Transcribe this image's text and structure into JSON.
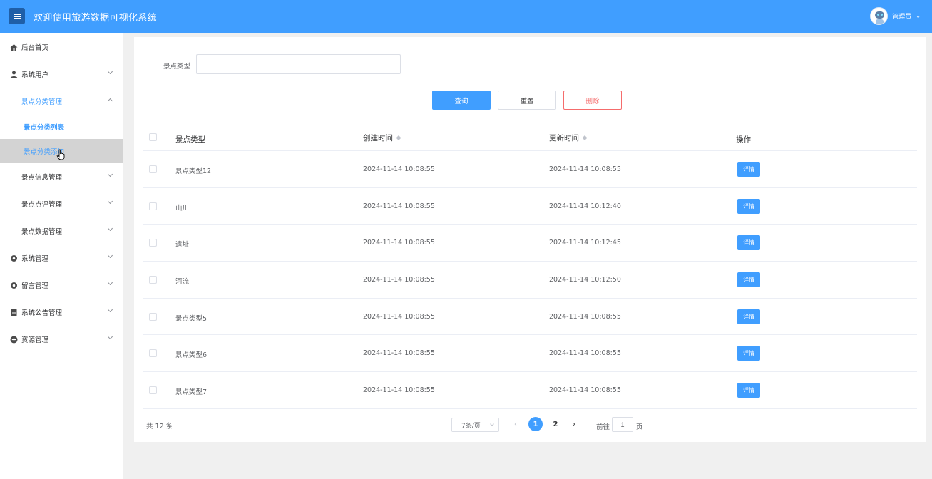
{
  "app": {
    "title": "欢迎使用旅游数据可视化系统"
  },
  "user": {
    "name": "管理员",
    "caret": "⌄"
  },
  "sidebar": {
    "items": [
      {
        "label": "后台首页"
      },
      {
        "label": "系统用户"
      },
      {
        "label": "景点分类管理"
      },
      {
        "label": "景点信息管理"
      },
      {
        "label": "景点点评管理"
      },
      {
        "label": "景点数据管理"
      },
      {
        "label": "系统管理"
      },
      {
        "label": "留言管理"
      },
      {
        "label": "系统公告管理"
      },
      {
        "label": "资源管理"
      }
    ],
    "sub_items": [
      {
        "label": "景点分类列表"
      },
      {
        "label": "景点分类添加"
      }
    ]
  },
  "filter": {
    "label": "景点类型",
    "value": ""
  },
  "buttons": {
    "query": "查询",
    "reset": "重置",
    "delete": "删除"
  },
  "table": {
    "headers": {
      "type": "景点类型",
      "created": "创建时间",
      "updated": "更新时间",
      "action": "操作"
    },
    "rows": [
      {
        "type": "景点类型12",
        "created": "2024-11-14 10:08:55",
        "updated": "2024-11-14 10:08:55",
        "action": "详情"
      },
      {
        "type": "山川",
        "created": "2024-11-14 10:08:55",
        "updated": "2024-11-14 10:12:40",
        "action": "详情"
      },
      {
        "type": "遗址",
        "created": "2024-11-14 10:08:55",
        "updated": "2024-11-14 10:12:45",
        "action": "详情"
      },
      {
        "type": "河流",
        "created": "2024-11-14 10:08:55",
        "updated": "2024-11-14 10:12:50",
        "action": "详情"
      },
      {
        "type": "景点类型5",
        "created": "2024-11-14 10:08:55",
        "updated": "2024-11-14 10:08:55",
        "action": "详情"
      },
      {
        "type": "景点类型6",
        "created": "2024-11-14 10:08:55",
        "updated": "2024-11-14 10:08:55",
        "action": "详情"
      },
      {
        "type": "景点类型7",
        "created": "2024-11-14 10:08:55",
        "updated": "2024-11-14 10:08:55",
        "action": "详情"
      }
    ]
  },
  "pagination": {
    "total": "共 12 条",
    "page_size": "7条/页",
    "prev": "‹",
    "next": "›",
    "pages": [
      "1",
      "2"
    ],
    "current_page": 1,
    "goto_pre": "前往",
    "goto_value": "1",
    "goto_post": "页"
  },
  "colors": {
    "primary": "#409eff",
    "danger": "#f56c6c",
    "topbar": "#409eff"
  }
}
